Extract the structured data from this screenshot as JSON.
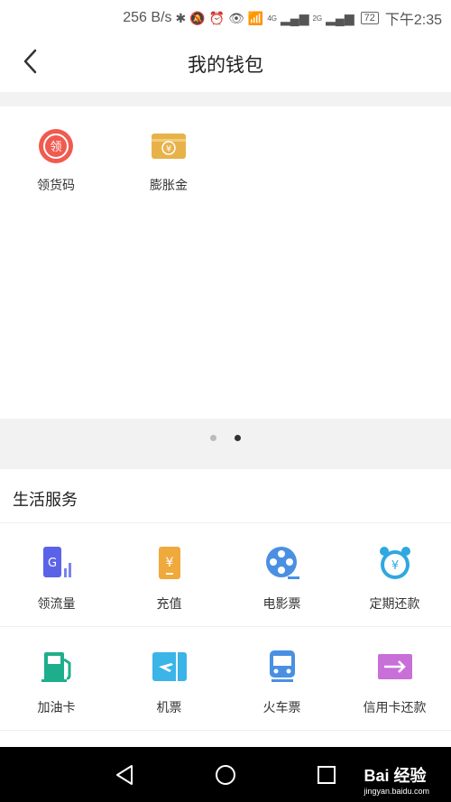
{
  "status_bar": {
    "speed": "256 B/s",
    "net1": "4G",
    "net2": "2G",
    "battery": "72",
    "time": "下午2:35"
  },
  "header": {
    "title": "我的钱包",
    "back_icon": "chevron-left-icon"
  },
  "wallet": {
    "items": [
      {
        "label": "领货码",
        "icon": "coupon-code-icon",
        "color": "#f15a4f"
      },
      {
        "label": "膨胀金",
        "icon": "money-ticket-icon",
        "color": "#e8b24a"
      }
    ]
  },
  "pager": {
    "count": 2,
    "active": 2
  },
  "services": {
    "title": "生活服务",
    "rows": [
      [
        {
          "label": "领流量",
          "icon": "phone-data-icon",
          "color": "#5a63e8"
        },
        {
          "label": "充值",
          "icon": "phone-recharge-icon",
          "color": "#f0a93c"
        },
        {
          "label": "电影票",
          "icon": "film-reel-icon",
          "color": "#4a90e2"
        },
        {
          "label": "定期还款",
          "icon": "alarm-clock-yuan-icon",
          "color": "#2fa8e0"
        }
      ],
      [
        {
          "label": "加油卡",
          "icon": "fuel-pump-icon",
          "color": "#1fae8c"
        },
        {
          "label": "机票",
          "icon": "plane-ticket-icon",
          "color": "#3bb4e8"
        },
        {
          "label": "火车票",
          "icon": "train-icon",
          "color": "#4a90e2"
        },
        {
          "label": "信用卡还款",
          "icon": "credit-card-icon",
          "color": "#c86fd8"
        }
      ]
    ]
  },
  "nav": {
    "watermark": "Bai 经验",
    "watermark_sub": "jingyan.baidu.com"
  }
}
